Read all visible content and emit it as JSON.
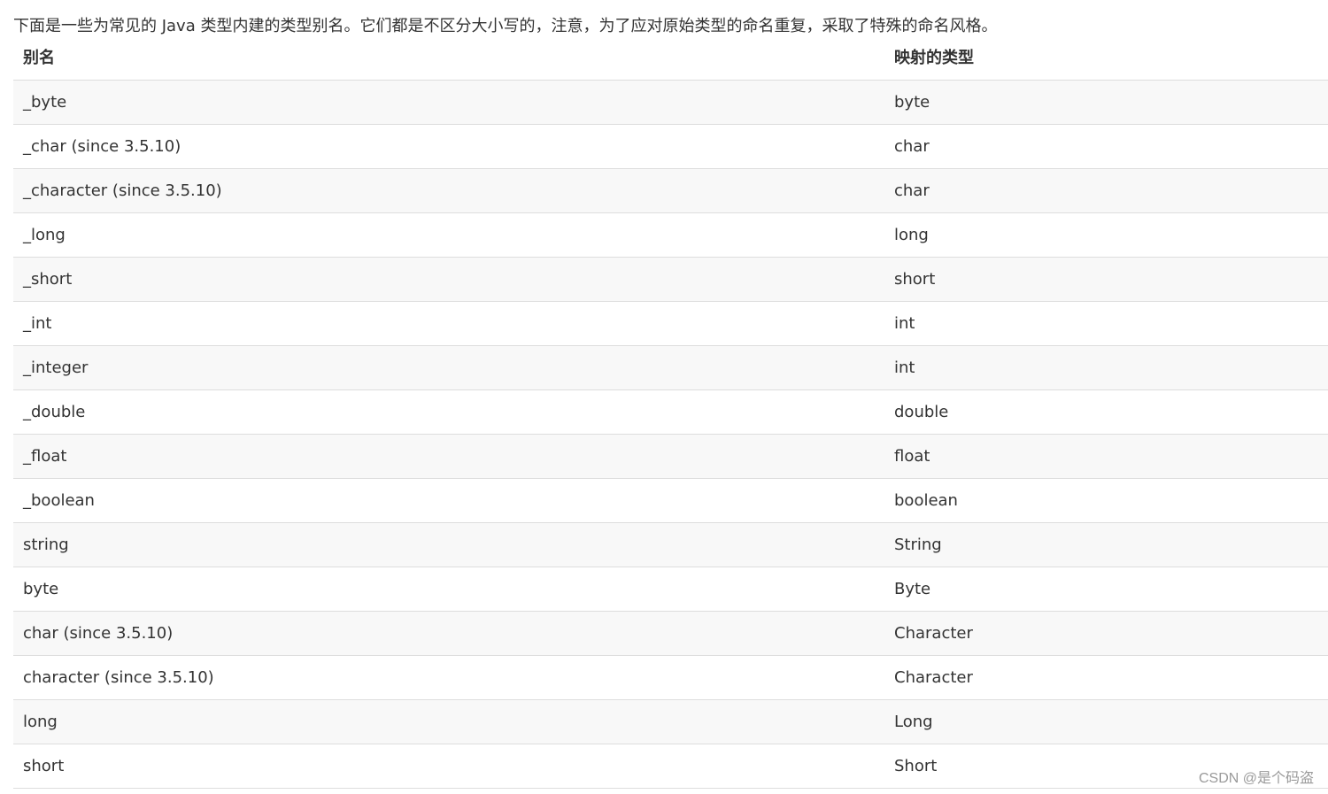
{
  "intro_text": "下面是一些为常见的 Java 类型内建的类型别名。它们都是不区分大小写的，注意，为了应对原始类型的命名重复，采取了特殊的命名风格。",
  "table": {
    "headers": [
      "别名",
      "映射的类型"
    ],
    "rows": [
      [
        "_byte",
        "byte"
      ],
      [
        "_char (since 3.5.10)",
        "char"
      ],
      [
        "_character (since 3.5.10)",
        "char"
      ],
      [
        "_long",
        "long"
      ],
      [
        "_short",
        "short"
      ],
      [
        "_int",
        "int"
      ],
      [
        "_integer",
        "int"
      ],
      [
        "_double",
        "double"
      ],
      [
        "_float",
        "float"
      ],
      [
        "_boolean",
        "boolean"
      ],
      [
        "string",
        "String"
      ],
      [
        "byte",
        "Byte"
      ],
      [
        "char (since 3.5.10)",
        "Character"
      ],
      [
        "character (since 3.5.10)",
        "Character"
      ],
      [
        "long",
        "Long"
      ],
      [
        "short",
        "Short"
      ]
    ]
  },
  "watermark": "CSDN @是个码盗",
  "colors": {
    "text": "#333333",
    "stripe": "#f8f8f8",
    "border": "#dddddd",
    "watermark": "#9a9a9a"
  }
}
